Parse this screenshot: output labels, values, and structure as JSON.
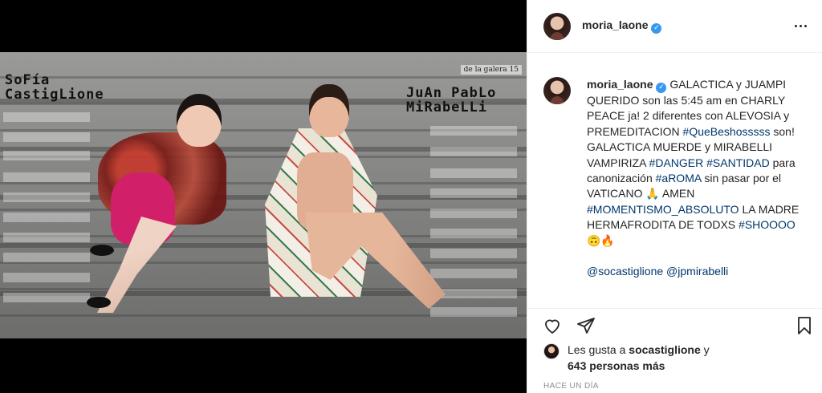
{
  "post": {
    "username": "moria_laone",
    "verified": true
  },
  "magazine": {
    "name_left": "SoFía CastigLione",
    "name_right": "JuAn PabLo MiRabeLLi",
    "header": "de la galera 15"
  },
  "caption": {
    "username": "moria_laone",
    "segments": [
      {
        "text": " GALACTICA y JUAMPI QUERIDO son las 5:45 am en CHARLY PEACE ja! 2 diferentes con ALEVOSIA y PREMEDITACION ",
        "tag": false
      },
      {
        "text": "#QueBeshosssss",
        "tag": true
      },
      {
        "text": " son! GALACTICA MUERDE y MIRABELLI VAMPIRIZA ",
        "tag": false
      },
      {
        "text": "#DANGER",
        "tag": true
      },
      {
        "text": " ",
        "tag": false
      },
      {
        "text": "#SANTIDAD",
        "tag": true
      },
      {
        "text": " para canonización ",
        "tag": false
      },
      {
        "text": "#aROMA",
        "tag": true
      },
      {
        "text": " sin pasar por el VATICANO 🙏 AMEN ",
        "tag": false
      },
      {
        "text": "#MOMENTISMO_ABSOLUTO",
        "tag": true
      },
      {
        "text": " LA MADRE HERMAFRODITA DE TODXS ",
        "tag": false
      },
      {
        "text": "#SHOOOO",
        "tag": true
      },
      {
        "text": "🙃🔥",
        "tag": false
      }
    ],
    "mentions": [
      {
        "text": "@socastiglione",
        "tag": true
      },
      {
        "text": " ",
        "tag": false
      },
      {
        "text": "@jpmirabelli",
        "tag": true
      }
    ]
  },
  "actions": {
    "like_icon": "heart-icon",
    "comment_icon": "comment-icon",
    "share_icon": "send-icon",
    "save_icon": "bookmark-icon"
  },
  "likes": {
    "prefix": "Les gusta a ",
    "user": "socastiglione",
    "suffix": " y",
    "others_count": "643 personas más"
  },
  "timestamp": "HACE UN DÍA",
  "colors": {
    "link": "#00376b",
    "verified": "#3897f0",
    "muted": "#8e8e8e"
  }
}
